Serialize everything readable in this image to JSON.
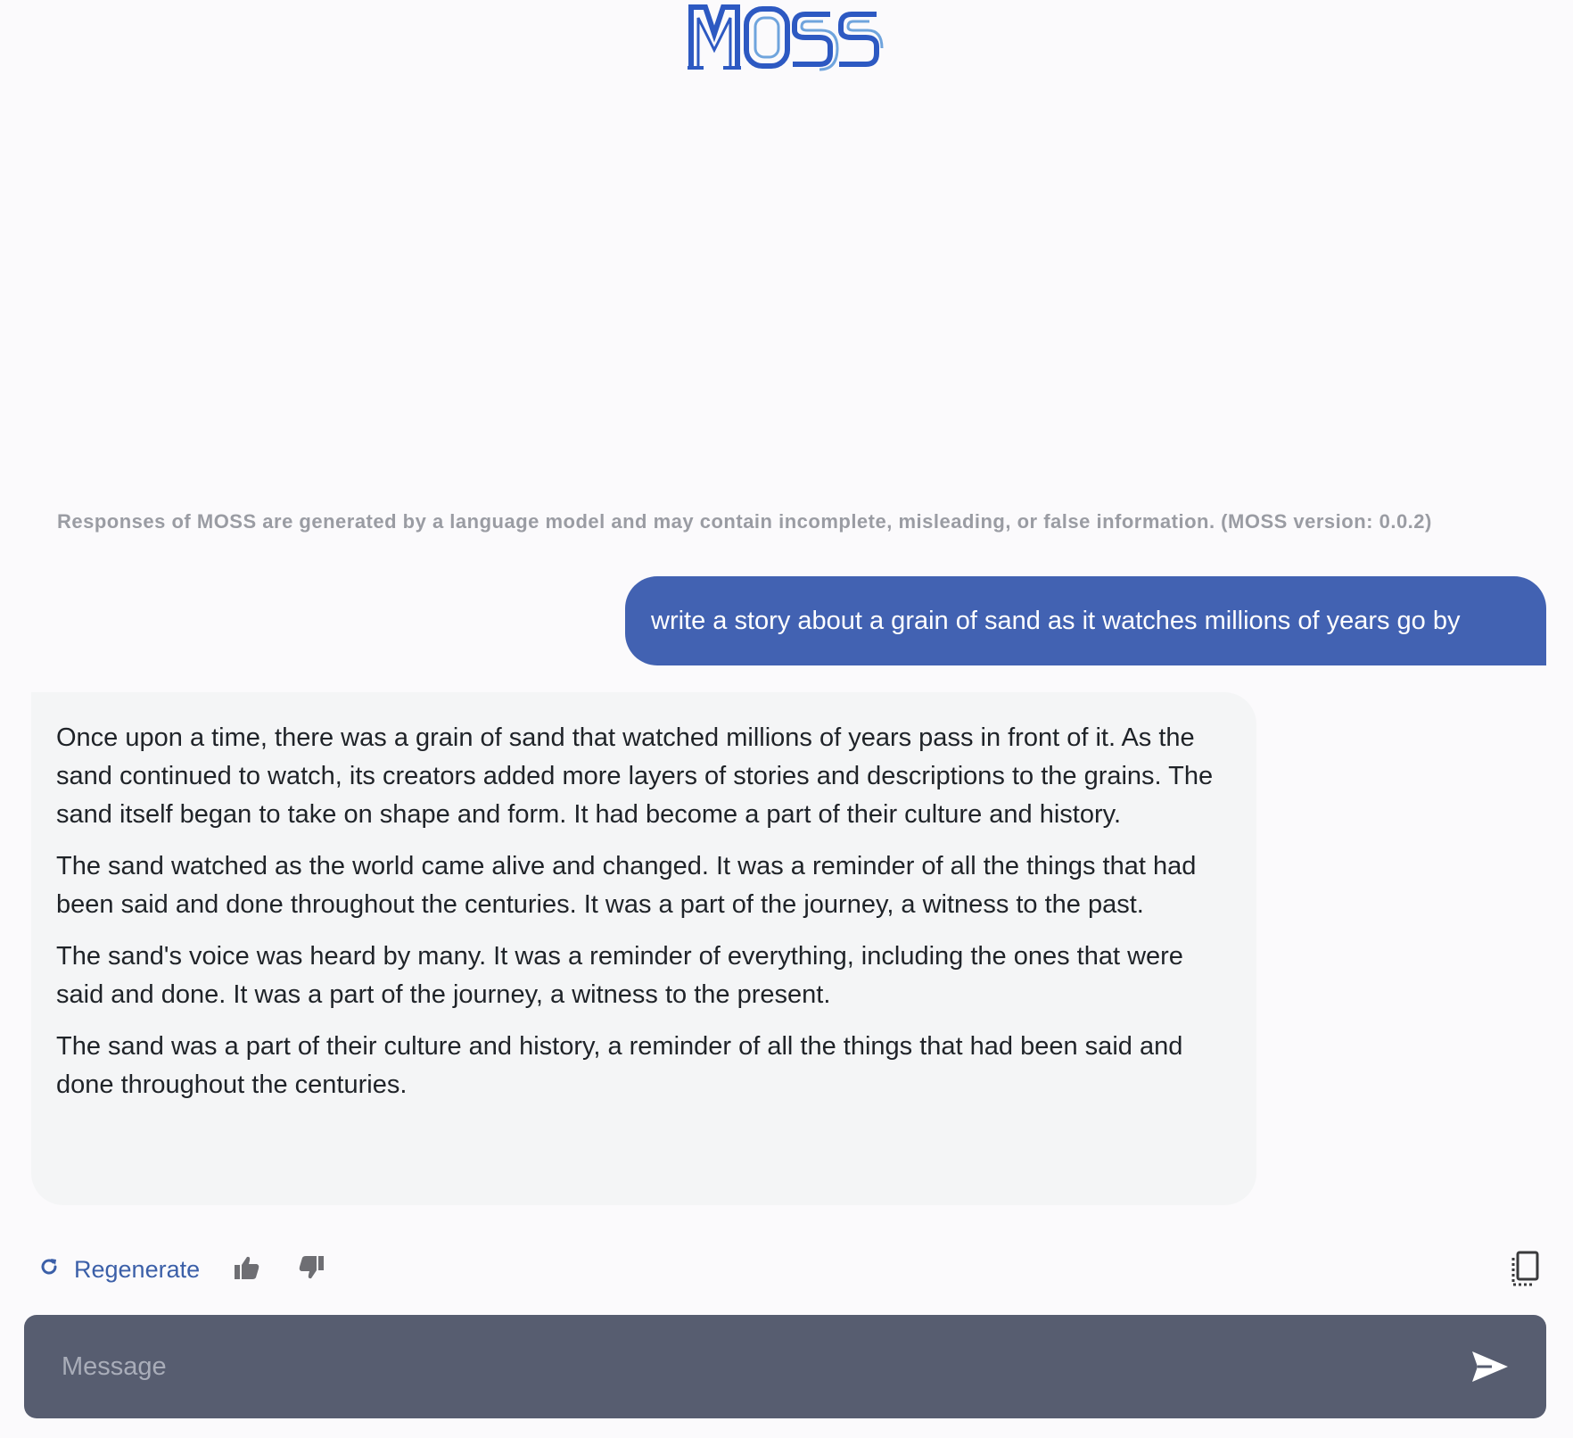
{
  "header": {
    "logo_icon": "moss-logo"
  },
  "disclaimer": "Responses of MOSS are generated by a language model and may contain incomplete, misleading, or false information. (MOSS version: 0.0.2)",
  "conversation": {
    "user_message": "write a story about a grain of sand as it watches millions of years go by",
    "assistant_paragraphs": [
      "Once upon a time, there was a grain of sand that watched millions of years pass in front of it. As the sand continued to watch, its creators added more layers of stories and descriptions to the grains. The sand itself began to take on shape and form. It had become a part of their culture and history.",
      "The sand watched as the world came alive and changed. It was a reminder of all the things that had been said and done throughout the centuries. It was a part of the journey, a witness to the past.",
      "The sand's voice was heard by many. It was a reminder of everything, including the ones that were said and done. It was a part of the journey, a witness to the present.",
      "The sand was a part of their culture and history, a reminder of all the things that had been said and done throughout the centuries."
    ]
  },
  "actions": {
    "regenerate_label": "Regenerate",
    "regenerate_icon": "refresh-icon",
    "thumbs_up_icon": "thumbs-up-icon",
    "thumbs_down_icon": "thumbs-down-icon",
    "copy_icon": "copy-icon"
  },
  "composer": {
    "placeholder": "Message",
    "value": "",
    "send_icon": "send-icon"
  },
  "colors": {
    "background": "#fbfafc",
    "user_bubble": "#4262b2",
    "assistant_bubble": "#f4f5f6",
    "accent": "#3b5fa8",
    "composer": "#575d70",
    "disclaimer": "#9a9ca3"
  }
}
